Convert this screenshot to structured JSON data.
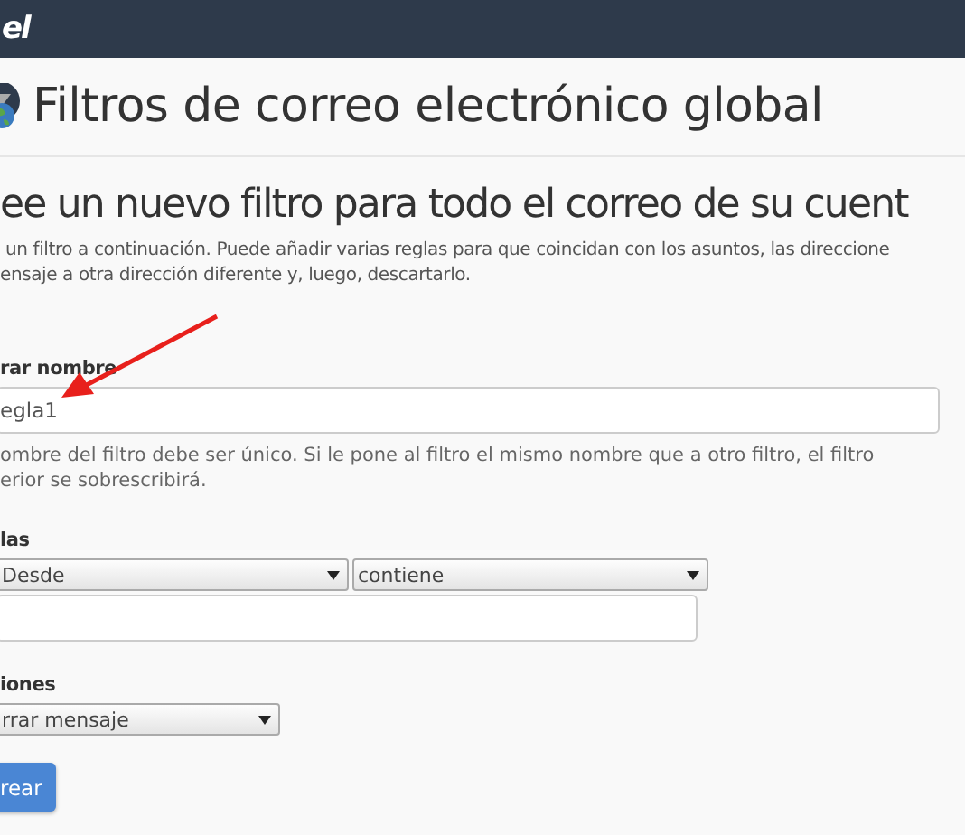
{
  "top_bar": {
    "logo": "el"
  },
  "page_title": "Filtros de correo electrónico global",
  "section": {
    "heading": "ee un nuevo filtro para todo el correo de su cuent",
    "description": [
      "un filtro a continuación. Puede añadir varias reglas para que coincidan con los asuntos, las direccione",
      "ensaje a otra dirección diferente y, luego, descartarlo."
    ]
  },
  "filter_name": {
    "label": "rar nombre",
    "value": "egla1",
    "help": [
      "ombre del filtro debe ser único. Si le pone al filtro el mismo nombre que a otro filtro, el filtro",
      "erior se sobrescribirá."
    ]
  },
  "rules": {
    "label": "las",
    "field": "Desde",
    "condition": "contiene"
  },
  "actions": {
    "label": "iones",
    "action": "rrar mensaje"
  },
  "submit_button": "rear"
}
